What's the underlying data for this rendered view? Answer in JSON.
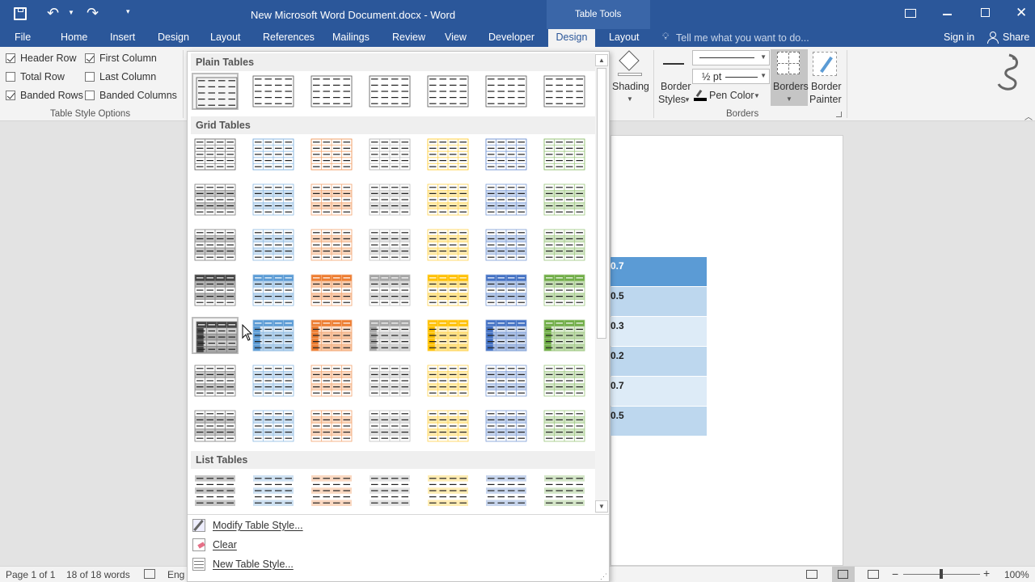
{
  "titlebar": {
    "doc_title": "New Microsoft Word Document.docx - Word",
    "context_title": "Table Tools"
  },
  "tabs": [
    {
      "label": "File"
    },
    {
      "label": "Home"
    },
    {
      "label": "Insert"
    },
    {
      "label": "Design"
    },
    {
      "label": "Layout"
    },
    {
      "label": "References"
    },
    {
      "label": "Mailings"
    },
    {
      "label": "Review"
    },
    {
      "label": "View"
    },
    {
      "label": "Developer"
    },
    {
      "label": "Design"
    },
    {
      "label": "Layout"
    }
  ],
  "tell_me": "Tell me what you want to do...",
  "sign_in": "Sign in",
  "share": "Share",
  "style_options": {
    "header_row": "Header Row",
    "first_column": "First Column",
    "total_row": "Total Row",
    "last_column": "Last Column",
    "banded_rows": "Banded Rows",
    "banded_columns": "Banded Columns",
    "group_label": "Table Style Options"
  },
  "borders_group": {
    "shading": "Shading",
    "border_styles_1": "Border",
    "border_styles_2": "Styles",
    "pen_weight": "½ pt",
    "pen_color": "Pen Color",
    "borders": "Borders",
    "border_painter_1": "Border",
    "border_painter_2": "Painter",
    "group_label": "Borders"
  },
  "gallery": {
    "plain_tables": "Plain Tables",
    "grid_tables": "Grid Tables",
    "list_tables": "List Tables",
    "grid_colors": [
      "#444444",
      "#5b9bd5",
      "#ed7d31",
      "#a5a5a5",
      "#ffc000",
      "#4472c4",
      "#70ad47"
    ],
    "menu": {
      "modify": "Modify Table Style...",
      "clear": "Clear",
      "new": "New Table Style..."
    }
  },
  "document": {
    "cells": [
      "0.7",
      "0.5",
      "0.3",
      "0.2",
      "0.7",
      "0.5"
    ]
  },
  "statusbar": {
    "page": "Page 1 of 1",
    "words": "18 of 18 words",
    "lang": "Eng",
    "zoom": "100%"
  }
}
